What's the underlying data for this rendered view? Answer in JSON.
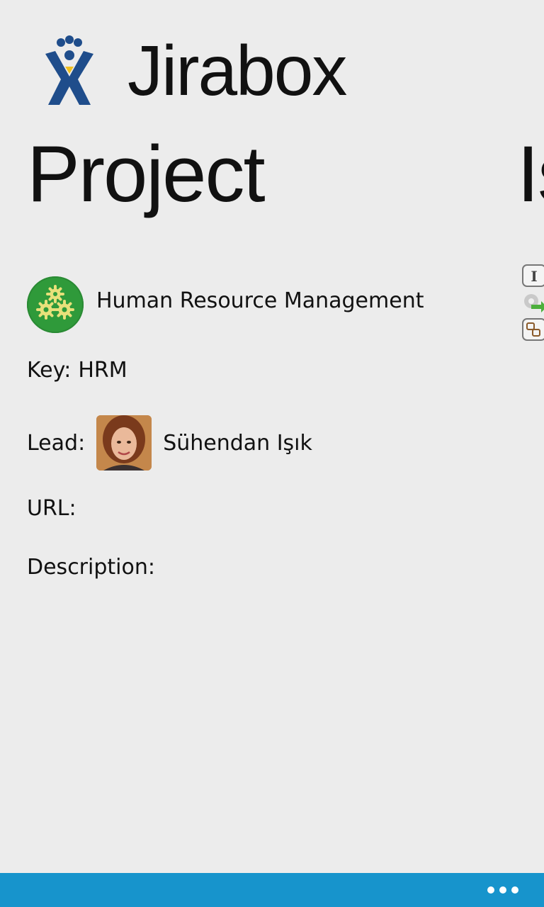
{
  "app": {
    "title": "Jirabox",
    "logo_icon": "jira-logo-icon"
  },
  "pivot": {
    "current": "Project",
    "next_peek": "Is"
  },
  "project": {
    "avatar_icon": "gears-icon",
    "name": "Human Resource Management",
    "key_label": "Key:",
    "key_value": "HRM",
    "lead_label": "Lead:",
    "lead_name": "Sühendan Işık",
    "url_label": "URL:",
    "url_value": "",
    "description_label": "Description:",
    "description_value": ""
  },
  "issue_type_icons": [
    "improvement-icon",
    "new-feature-icon",
    "sub-task-icon"
  ],
  "app_bar": {
    "more_icon": "ellipsis-icon"
  },
  "colors": {
    "background": "#ececec",
    "accent": "#1794cc",
    "project_avatar": "#2f9a3a",
    "jira_blue": "#1f4d8b"
  }
}
